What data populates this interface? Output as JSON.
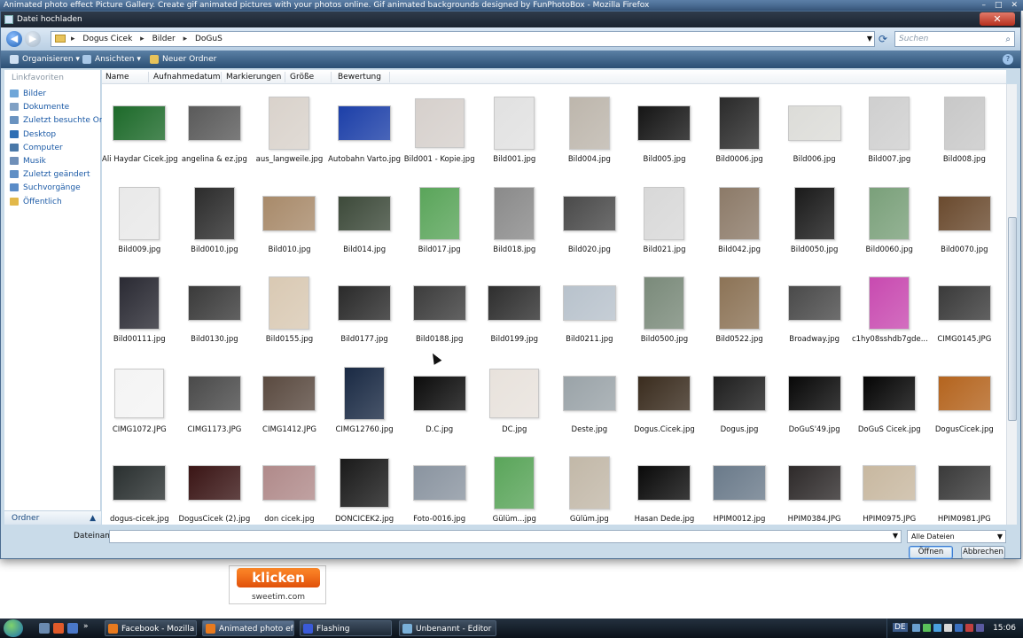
{
  "firefox": {
    "title": "Animated photo effect Picture Gallery. Create gif animated pictures with your photos online. Gif animated backgrounds designed by FunPhotoBox - Mozilla Firefox",
    "min": "–",
    "max": "□",
    "close": "✕"
  },
  "dialog": {
    "title": "Datei hochladen",
    "close": "✕",
    "address": {
      "crumbs": [
        "Dogus Cicek",
        "Bilder",
        "DoGuS"
      ],
      "separator": "▸"
    },
    "search_placeholder": "Suchen",
    "toolbar": {
      "organize": "Organisieren",
      "views": "Ansichten",
      "new_folder": "Neuer Ordner"
    },
    "columns": [
      "Name",
      "Aufnahmedatum",
      "Markierungen",
      "Größe",
      "Bewertung"
    ],
    "favorites_heading": "Linkfavoriten",
    "favorites": [
      {
        "label": "Bilder",
        "icon": "pictures-icon",
        "color": "#6fa6d8"
      },
      {
        "label": "Dokumente",
        "icon": "documents-icon",
        "color": "#7fa0c4"
      },
      {
        "label": "Zuletzt besuchte Orte",
        "icon": "recent-places-icon",
        "color": "#6a93c0"
      },
      {
        "label": "Desktop",
        "icon": "desktop-icon",
        "color": "#2f6fb4"
      },
      {
        "label": "Computer",
        "icon": "computer-icon",
        "color": "#4a78a8"
      },
      {
        "label": "Musik",
        "icon": "music-icon",
        "color": "#6f8fb8"
      },
      {
        "label": "Zuletzt geändert",
        "icon": "recently-changed-icon",
        "color": "#5f8fc5"
      },
      {
        "label": "Suchvorgänge",
        "icon": "searches-icon",
        "color": "#5a8cc8"
      },
      {
        "label": "Öffentlich",
        "icon": "public-icon",
        "color": "#e2b84a"
      }
    ],
    "folders_label": "Ordner",
    "filename_label": "Dateiname:",
    "filename_value": "",
    "filetype_value": "Alle Dateien",
    "open_label": "Öffnen",
    "cancel_label": "Abbrechen",
    "files": [
      {
        "name": "Ali Haydar Cicek.jpg",
        "color": "#1d6a2a",
        "orient": "land"
      },
      {
        "name": "angelina & ez.jpg",
        "color": "#5a5a5a",
        "orient": "land"
      },
      {
        "name": "aus_langweile.jpg",
        "color": "#d9d2cb",
        "orient": "port"
      },
      {
        "name": "Autobahn Varto.jpg",
        "color": "#1c3fa8",
        "orient": "land"
      },
      {
        "name": "Bild001 - Kopie.jpg",
        "color": "#d6d0cc",
        "orient": "sq"
      },
      {
        "name": "Bild001.jpg",
        "color": "#e1e1e1",
        "orient": "port"
      },
      {
        "name": "Bild004.jpg",
        "color": "#bdb6ac",
        "orient": "port"
      },
      {
        "name": "Bild005.jpg",
        "color": "#151515",
        "orient": "land"
      },
      {
        "name": "Bild0006.jpg",
        "color": "#2a2a2a",
        "orient": "port"
      },
      {
        "name": "Bild006.jpg",
        "color": "#dcdcd8",
        "orient": "land"
      },
      {
        "name": "Bild007.jpg",
        "color": "#cfcfcf",
        "orient": "port"
      },
      {
        "name": "Bild008.jpg",
        "color": "#c8c8c8",
        "orient": "port"
      },
      {
        "name": "Bild009.jpg",
        "color": "#e9e9e9",
        "orient": "port"
      },
      {
        "name": "Bild0010.jpg",
        "color": "#2c2c2c",
        "orient": "port"
      },
      {
        "name": "Bild010.jpg",
        "color": "#a88a6a",
        "orient": "land"
      },
      {
        "name": "Bild014.jpg",
        "color": "#3d4a3a",
        "orient": "land"
      },
      {
        "name": "Bild017.jpg",
        "color": "#5aa55a",
        "orient": "port"
      },
      {
        "name": "Bild018.jpg",
        "color": "#8a8a8a",
        "orient": "port"
      },
      {
        "name": "Bild020.jpg",
        "color": "#4a4a4a",
        "orient": "land"
      },
      {
        "name": "Bild021.jpg",
        "color": "#d8d8d8",
        "orient": "port"
      },
      {
        "name": "Bild042.jpg",
        "color": "#8c7a68",
        "orient": "port"
      },
      {
        "name": "Bild0050.jpg",
        "color": "#1a1a1a",
        "orient": "port"
      },
      {
        "name": "Bild0060.jpg",
        "color": "#7aa07a",
        "orient": "port"
      },
      {
        "name": "Bild0070.jpg",
        "color": "#6a4a2e",
        "orient": "land"
      },
      {
        "name": "Bild00111.jpg",
        "color": "#2a2a33",
        "orient": "port"
      },
      {
        "name": "Bild0130.jpg",
        "color": "#3a3a3a",
        "orient": "land"
      },
      {
        "name": "Bild0155.jpg",
        "color": "#d9c9b3",
        "orient": "port"
      },
      {
        "name": "Bild0177.jpg",
        "color": "#2a2a2a",
        "orient": "land"
      },
      {
        "name": "Bild0188.jpg",
        "color": "#3c3c3c",
        "orient": "land"
      },
      {
        "name": "Bild0199.jpg",
        "color": "#2e2e2e",
        "orient": "land"
      },
      {
        "name": "Bild0211.jpg",
        "color": "#b8c2cc",
        "orient": "land"
      },
      {
        "name": "Bild0500.jpg",
        "color": "#7a8a7a",
        "orient": "port"
      },
      {
        "name": "Bild0522.jpg",
        "color": "#8c7356",
        "orient": "port"
      },
      {
        "name": "Broadway.jpg",
        "color": "#4a4a4a",
        "orient": "land"
      },
      {
        "name": "c1hy08sshdb7gde...",
        "color": "#c84ab0",
        "orient": "port"
      },
      {
        "name": "CIMG0145.JPG",
        "color": "#3a3a3a",
        "orient": "land"
      },
      {
        "name": "CIMG1072.JPG",
        "color": "#f4f4f4",
        "orient": "sq"
      },
      {
        "name": "CIMG1173.JPG",
        "color": "#4a4a4a",
        "orient": "land"
      },
      {
        "name": "CIMG1412.JPG",
        "color": "#5a4a40",
        "orient": "land"
      },
      {
        "name": "CIMG12760.jpg",
        "color": "#1a2a44",
        "orient": "port"
      },
      {
        "name": "D.C.jpg",
        "color": "#0c0c0c",
        "orient": "land"
      },
      {
        "name": "DC.jpg",
        "color": "#e8e2dc",
        "orient": "sq"
      },
      {
        "name": "Deste.jpg",
        "color": "#9aa3a8",
        "orient": "land"
      },
      {
        "name": "Dogus.Cicek.jpg",
        "color": "#3a2c1e",
        "orient": "land"
      },
      {
        "name": "Dogus.jpg",
        "color": "#1e1e1e",
        "orient": "land"
      },
      {
        "name": "DoGuS'49.jpg",
        "color": "#080808",
        "orient": "land"
      },
      {
        "name": "DoGuS Cicek.jpg",
        "color": "#050505",
        "orient": "land"
      },
      {
        "name": "DogusCicek.jpg",
        "color": "#b4641e",
        "orient": "land"
      },
      {
        "name": "dogus-cicek.jpg",
        "color": "#2a3030",
        "orient": "land"
      },
      {
        "name": "DogusCicek (2).jpg",
        "color": "#3a1515",
        "orient": "land"
      },
      {
        "name": "don cicek.jpg",
        "color": "#b08a8a",
        "orient": "land"
      },
      {
        "name": "DONCICEK2.jpg",
        "color": "#1a1a1a",
        "orient": "sq"
      },
      {
        "name": "Foto-0016.jpg",
        "color": "#8a94a0",
        "orient": "land"
      },
      {
        "name": "Gülüm...jpg",
        "color": "#5aa55a",
        "orient": "port"
      },
      {
        "name": "Gülüm.jpg",
        "color": "#c2b8a8",
        "orient": "port"
      },
      {
        "name": "Hasan Dede.jpg",
        "color": "#0a0a0a",
        "orient": "land"
      },
      {
        "name": "HPIM0012.jpg",
        "color": "#6a7a8a",
        "orient": "land"
      },
      {
        "name": "HPIM0384.JPG",
        "color": "#2e2a2a",
        "orient": "land"
      },
      {
        "name": "HPIM0975.JPG",
        "color": "#c8b8a0",
        "orient": "land"
      },
      {
        "name": "HPIM0981.JPG",
        "color": "#3a3a3a",
        "orient": "land"
      }
    ]
  },
  "ad": {
    "button": "klicken",
    "site": "sweetim.com"
  },
  "taskbar": {
    "tasks": [
      {
        "label": "Facebook - Mozilla ...",
        "color": "#e87a1e",
        "active": false
      },
      {
        "label": "Animated photo eff...",
        "color": "#e87a1e",
        "active": true
      },
      {
        "label": "Flashing",
        "color": "#3a5ad8",
        "active": false
      },
      {
        "label": "Unbenannt - Editor",
        "color": "#7ab0d8",
        "active": false
      }
    ],
    "lang": "DE",
    "clock": "15:06"
  }
}
